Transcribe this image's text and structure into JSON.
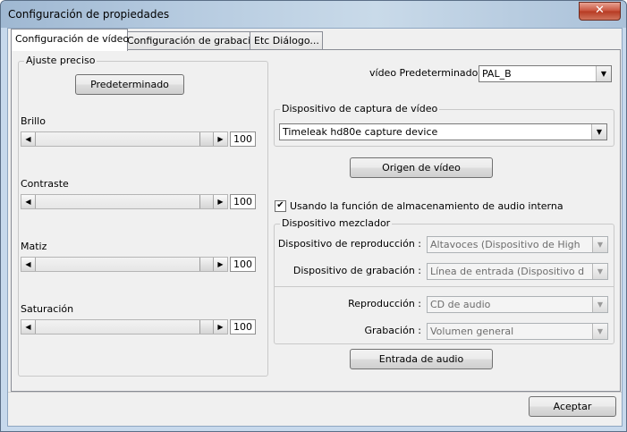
{
  "window": {
    "title": "Configuración de propiedades",
    "close_glyph": "✕"
  },
  "tabs": [
    {
      "label": "Configuración de vídeo"
    },
    {
      "label": "Configuración de grabación"
    },
    {
      "label": "Etc Diálogo..."
    }
  ],
  "fine_tune": {
    "group_label": "Ajuste preciso",
    "default_button": "Predeterminado",
    "sliders": [
      {
        "label": "Brillo",
        "value": "100"
      },
      {
        "label": "Contraste",
        "value": "100"
      },
      {
        "label": "Matiz",
        "value": "100"
      },
      {
        "label": "Saturación",
        "value": "100"
      }
    ]
  },
  "video_default": {
    "label": "vídeo Predeterminado :",
    "value": "PAL_B"
  },
  "capture_device": {
    "group_label": "Dispositivo de captura de vídeo",
    "value": "Timeleak hd80e capture device"
  },
  "video_source_button": "Origen de vídeo",
  "internal_audio": {
    "label": "Usando la función de almacenamiento de audio interna",
    "checked": true,
    "check_glyph": "✔"
  },
  "mixer": {
    "group_label": "Dispositivo mezclador",
    "playback_device": {
      "label": "Dispositivo de reproducción :",
      "value": "Altavoces (Dispositivo de High"
    },
    "recording_device": {
      "label": "Dispositivo de grabación :",
      "value": "Línea de entrada (Dispositivo d"
    },
    "playback": {
      "label": "Reproducción :",
      "value": "CD de audio"
    },
    "recording": {
      "label": "Grabación :",
      "value": "Volumen general"
    }
  },
  "audio_input_button": "Entrada de audio",
  "ok_button": "Aceptar",
  "arrows": {
    "down": "▼",
    "left": "◀",
    "right": "▶"
  }
}
